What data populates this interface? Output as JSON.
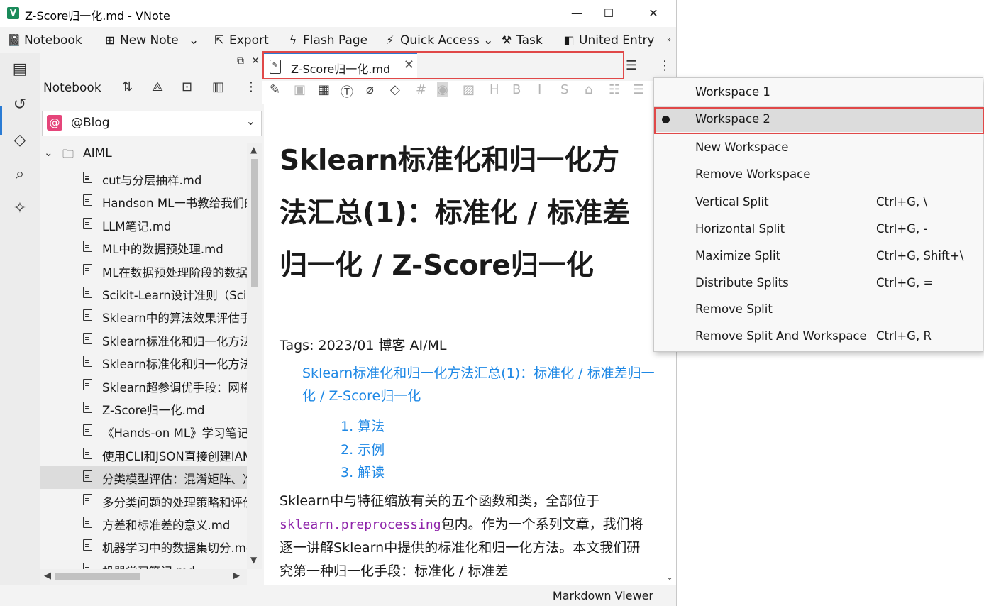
{
  "window": {
    "title": "Z-Score归一化.md - VNote",
    "app_icon": "V",
    "min": "—",
    "max": "☐",
    "close": "✕"
  },
  "menubar": {
    "notebook": "Notebook",
    "new_note": "New Note",
    "export": "Export",
    "flash_page": "Flash Page",
    "quick_access": "Quick Access",
    "task": "Task",
    "united_entry": "United Entry"
  },
  "explorer": {
    "header": "Notebook",
    "notebook_name": "@Blog",
    "folder": "AIML",
    "files": [
      "cut与分层抽样.md",
      "Handson ML一书教给我们的",
      "LLM笔记.md",
      "ML中的数据预处理.md",
      "ML在数据预处理阶段的数据",
      "Scikit-Learn设计准则（Scik",
      "Sklearn中的算法效果评估手",
      "Sklearn标准化和归一化方法",
      "Sklearn标准化和归一化方法",
      "Sklearn超参调优手段：网格",
      "Z-Score归一化.md",
      "《Hands-on ML》学习笔记",
      "使用CLI和JSON直接创建IAM",
      "分类模型评估：混淆矩阵、准",
      "多分类问题的处理策略和评价",
      "方差和标准差的意义.md",
      "机器学习中的数据集切分.md",
      "机器学习笔记.md"
    ],
    "selected_index": 13
  },
  "tab": {
    "label": "Z-Score归一化.md"
  },
  "document": {
    "title": "Sklearn标准化和归一化方法汇总(1)：标准化 / 标准差归一化 / Z-Score归一化",
    "tags": "Tags: 2023/01 博客 AI/ML",
    "toc_title": "Sklearn标准化和归一化方法汇总(1)：标准化 / 标准差归一化 / Z-Score归一化",
    "toc_items": [
      "1. 算法",
      "2. 示例",
      "3. 解读"
    ],
    "para_before": "Sklearn中与特征缩放有关的五个函数和类，全部位于",
    "para_code": "sklearn.preprocessing",
    "para_after": "包内。作为一个系列文章，我们将逐一讲解Sklearn中提供的标准化和归一化方法。本文我们研究第一种归一化手段：标准化 / 标准差"
  },
  "status": "Markdown Viewer",
  "popup": {
    "items": [
      {
        "label": "Workspace 1",
        "shortcut": "",
        "checked": false
      },
      {
        "label": "Workspace 2",
        "shortcut": "",
        "checked": true
      },
      {
        "label": "New Workspace",
        "shortcut": "",
        "checked": false
      },
      {
        "label": "Remove Workspace",
        "shortcut": "",
        "checked": false
      },
      {
        "label": "Vertical Split",
        "shortcut": "Ctrl+G, \\",
        "checked": false
      },
      {
        "label": "Horizontal Split",
        "shortcut": "Ctrl+G, -",
        "checked": false
      },
      {
        "label": "Maximize Split",
        "shortcut": "Ctrl+G, Shift+\\",
        "checked": false
      },
      {
        "label": "Distribute Splits",
        "shortcut": "Ctrl+G, =",
        "checked": false
      },
      {
        "label": "Remove Split",
        "shortcut": "",
        "checked": false
      },
      {
        "label": "Remove Split And Workspace",
        "shortcut": "Ctrl+G, R",
        "checked": false
      }
    ]
  },
  "colors": {
    "accent": "#2a7bd4",
    "highlight": "#e04848",
    "link": "#1e88e5",
    "code": "#8e24aa",
    "notebook_badge": "#e5457a"
  }
}
